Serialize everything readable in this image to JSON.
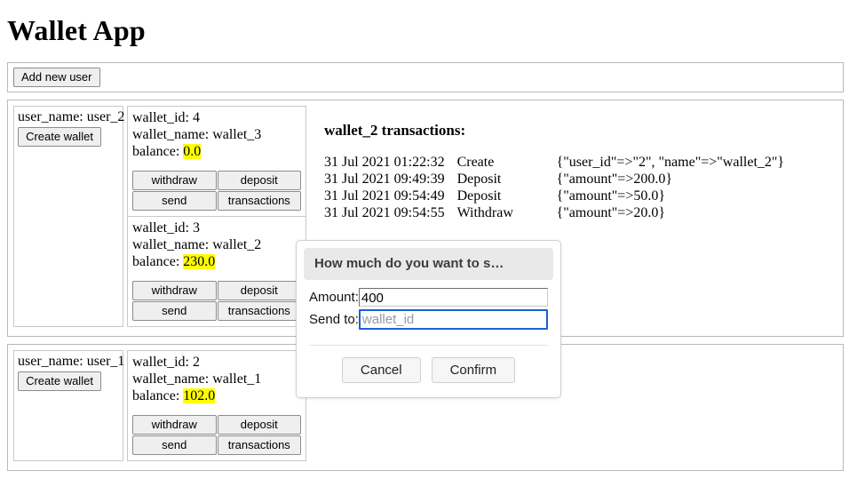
{
  "app": {
    "title": "Wallet App"
  },
  "toolbar": {
    "add_user_label": "Add new user"
  },
  "labels": {
    "create_wallet": "Create wallet",
    "withdraw": "withdraw",
    "deposit": "deposit",
    "send": "send",
    "transactions": "transactions"
  },
  "colors": {
    "highlight": "#ffff00",
    "focus_ring": "#1a62d6",
    "panel_border": "#b9b9b9",
    "modal_header_bg": "#e9e9e9"
  },
  "users": [
    {
      "user_name_line": "user_name: user_2",
      "wallets": [
        {
          "id_line": "wallet_id: 4",
          "name_line": "wallet_name: wallet_3",
          "balance_label": "balance:",
          "balance_value": "0.0"
        },
        {
          "id_line": "wallet_id: 3",
          "name_line": "wallet_name: wallet_2",
          "balance_label": "balance:",
          "balance_value": "230.0"
        }
      ]
    },
    {
      "user_name_line": "user_name: user_1",
      "wallets": [
        {
          "id_line": "wallet_id: 2",
          "name_line": "wallet_name: wallet_1",
          "balance_label": "balance:",
          "balance_value": "102.0"
        }
      ]
    }
  ],
  "transactions_panel": {
    "title": "wallet_2 transactions:",
    "rows": [
      {
        "timestamp": "31 Jul 2021 01:22:32",
        "kind": "Create",
        "details": "{\"user_id\"=>\"2\", \"name\"=>\"wallet_2\"}"
      },
      {
        "timestamp": "31 Jul 2021 09:49:39",
        "kind": "Deposit",
        "details": "{\"amount\"=>200.0}"
      },
      {
        "timestamp": "31 Jul 2021 09:54:49",
        "kind": "Deposit",
        "details": "{\"amount\"=>50.0}"
      },
      {
        "timestamp": "31 Jul 2021 09:54:55",
        "kind": "Withdraw",
        "details": "{\"amount\"=>20.0}"
      }
    ]
  },
  "modal": {
    "title": "How much do you want to s…",
    "amount_label": "Amount:",
    "amount_value": "400",
    "sendto_label": "Send to:",
    "sendto_value": "",
    "sendto_placeholder": "wallet_id",
    "cancel_label": "Cancel",
    "confirm_label": "Confirm"
  }
}
